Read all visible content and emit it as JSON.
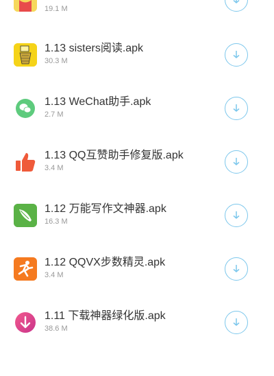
{
  "apps": [
    {
      "title": "",
      "size": "19.1 M",
      "icon": "avatar-icon",
      "color": "#f3d24d"
    },
    {
      "title": "1.13 sisters阅读.apk",
      "size": "30.3 M",
      "icon": "book-icon",
      "color": "#f5d319"
    },
    {
      "title": "1.13 WeChat助手.apk",
      "size": "2.7 M",
      "icon": "wechat-icon",
      "color": "#5ecb7d"
    },
    {
      "title": "1.13 QQ互赞助手修复版.apk",
      "size": "3.4 M",
      "icon": "thumbs-up-icon",
      "color": "#ef5a3a"
    },
    {
      "title": "1.12 万能写作文神器.apk",
      "size": "16.3 M",
      "icon": "pen-icon",
      "color": "#5ab246"
    },
    {
      "title": "1.12 QQVX步数精灵.apk",
      "size": "3.4 M",
      "icon": "runner-icon",
      "color": "#f57a20"
    },
    {
      "title": "1.11 下载神器绿化版.apk",
      "size": "38.6 M",
      "icon": "download-arrow-icon",
      "color": "#e8457a"
    }
  ],
  "accent_color": "#7cc7ec"
}
